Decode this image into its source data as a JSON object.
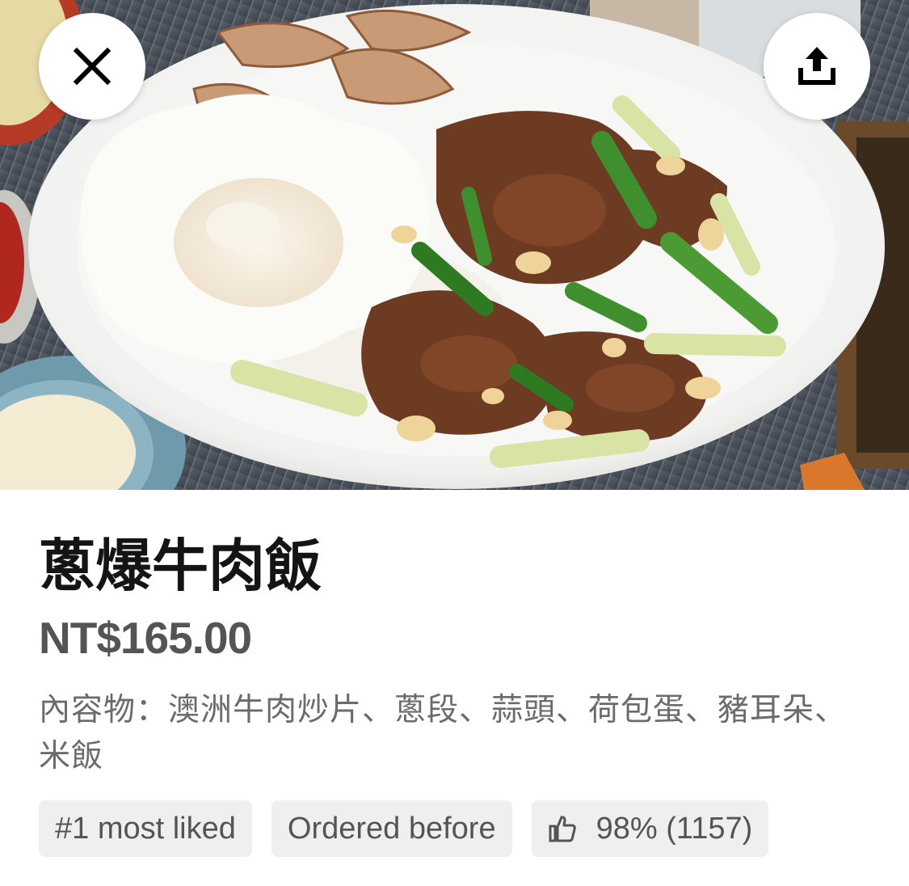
{
  "header": {
    "close_icon": "close-icon",
    "share_icon": "share-icon"
  },
  "item": {
    "name": "蔥爆牛肉飯",
    "price": "NT$165.00",
    "description": "內容物：澳洲牛肉炒片、蔥段、蒜頭、荷包蛋、豬耳朵、米飯"
  },
  "badges": {
    "most_liked": "#1 most liked",
    "ordered_before": "Ordered before",
    "rating_icon": "thumbs-up-icon",
    "rating": "98% (1157)"
  },
  "colors": {
    "title": "#141414",
    "price": "#545454",
    "description": "#6b6b6b",
    "badge_bg": "#efefef"
  }
}
